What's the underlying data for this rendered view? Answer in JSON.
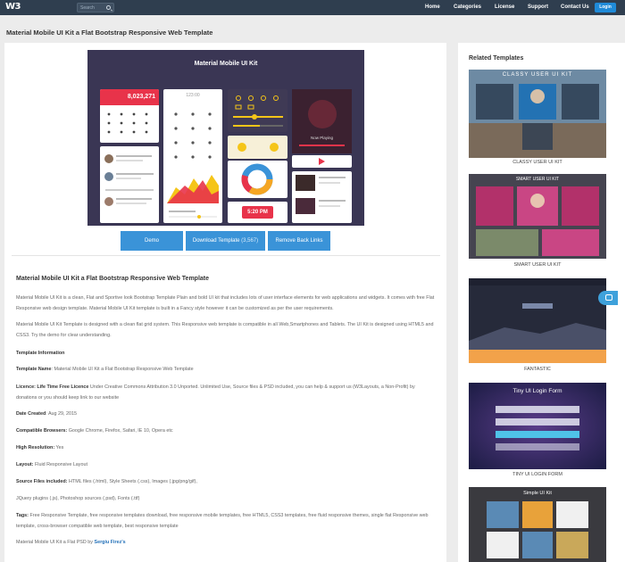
{
  "nav": {
    "logo": "W3",
    "search_placeholder": "Search",
    "items": [
      "Home",
      "Categories",
      "License",
      "Support",
      "Contact Us"
    ],
    "login": "Login"
  },
  "page_title": "Material Mobile UI Kit a Flat Bootstrap Responsive Web Template",
  "preview": {
    "title": "Material Mobile UI Kit",
    "counter": "8,023,271",
    "time_readout": "123:00",
    "now_playing": "Now Playing",
    "clock": "5:20 PM"
  },
  "buttons": {
    "demo": "Demo",
    "download": "Download Template",
    "download_count": "(3,567)",
    "remove": "Remove Back Links"
  },
  "content": {
    "heading": "Material Mobile UI Kit a Flat Bootstrap Responsive Web Template",
    "p1": "Material Mobile UI Kit is a clean, Flat and Sportive look Bootstrap Template Plain and bold UI kit that includes lots of user interface elements for web applications and widgets. It comes with free Flat Responsive web design template. Material Mobile UI Kit template is built in a Fancy style however it can be customized as per the user requirements.",
    "p2": "Material Mobile UI Kit Template is designed with a clean flat grid system. This Responsive web template is compatible in all Web,Smartphones and Tablets. The UI Kit is designed using HTML5 and CSS3. Try the demo for clear understanding.",
    "info_heading": "Template Information",
    "template_name_label": "Template Name",
    "template_name_value": ": Material Mobile UI Kit a Flat Bootstrap Responsive Web Template",
    "license_label": "Licence",
    "license_strong": ": Life Time Free Licence",
    "license_value": " Under Creative Commons Attribution 3.0 Unported. Unlimited Use, Source files & PSD included, you can help & support us (W3Layouts, a Non-Profit) by donations or you should keep link to our website",
    "date_label": "Date Created",
    "date_value": ": Aug 29, 2015",
    "browsers_label": "Compatible Browsers:",
    "browsers_value": " Google Chrome, Firefox, Safari, IE 10, Opera etc",
    "resolution_label": "High Resolution:",
    "resolution_value": " Yes",
    "layout_label": "Layout:",
    "layout_value": " Fluid Responsive Layout",
    "source_label": "Source Files included:",
    "source_value": " HTML files (.html), Style Sheets (.css), Images (.jpg/png/gif),",
    "source_value2": "JQuery plugins (.js), Photoshop sources (.psd), Fonts (.ttf)",
    "tags_label": "Tags:",
    "tags_value": " Free Responsive Template, free responsive templates download, free responsive mobile templates, free HTML5, CSS3 templates, free fluid responsive themes, single flat Responsive web template, cross-browser compatible web template, best responsive template",
    "credit": "Material Mobile UI Kit a Flat PSD by",
    "author": "Sergiu Firez's"
  },
  "sidebar": {
    "title": "Related Templates",
    "items": [
      {
        "label": "CLASSY USER UI KIT",
        "banner": "CLASSY USER UI KIT"
      },
      {
        "label": "SMART USER UI KIT",
        "banner": "SMART USER UI KIT"
      },
      {
        "label": "FANTASTIC",
        "banner": ""
      },
      {
        "label": "TINY UI LOGIN FORM",
        "banner": "Tiny UI Login Form"
      },
      {
        "label": "",
        "banner": "Simple UI Kit"
      }
    ]
  },
  "colors": {
    "nav_bg": "#2f3e4f",
    "accent_blue": "#3a93d8",
    "preview_bg": "#3a3654",
    "red": "#e8334a",
    "yellow": "#f5c518"
  }
}
